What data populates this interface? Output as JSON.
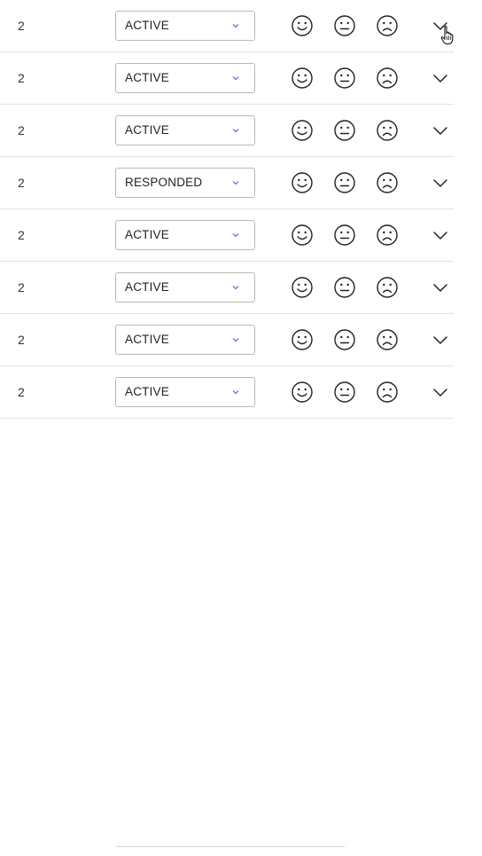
{
  "colors": {
    "row_divider": "#e3e3e3",
    "select_border": "#b9b9b9",
    "select_chevron": "#3f5bd6",
    "icon_stroke": "#222222"
  },
  "icons": {
    "happy": "smiley-happy-icon",
    "neutral": "smiley-neutral-icon",
    "sad": "smiley-sad-icon",
    "expand": "chevron-down-icon",
    "select": "chevron-down-icon",
    "cursor": "hand-pointer-cursor"
  },
  "rows": [
    {
      "count": "2",
      "status": "ACTIVE"
    },
    {
      "count": "2",
      "status": "ACTIVE"
    },
    {
      "count": "2",
      "status": "ACTIVE"
    },
    {
      "count": "2",
      "status": "RESPONDED"
    },
    {
      "count": "2",
      "status": "ACTIVE"
    },
    {
      "count": "2",
      "status": "ACTIVE"
    },
    {
      "count": "2",
      "status": "ACTIVE"
    },
    {
      "count": "2",
      "status": "ACTIVE"
    }
  ]
}
